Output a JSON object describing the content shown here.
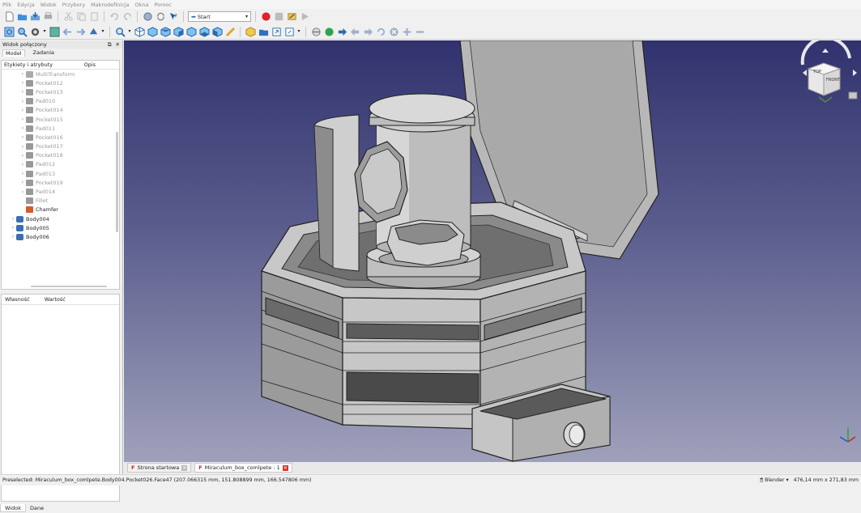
{
  "menu": [
    "Plik",
    "Edycja",
    "Widok",
    "Przybory",
    "Makrodefinicja",
    "Okna",
    "Pomoc"
  ],
  "toolbar": {
    "workbench": "Start"
  },
  "panel": {
    "title": "Widok połączony",
    "tabs": [
      "Model",
      "Zadania"
    ],
    "tree_header": {
      "col1": "Etykiety i atrybuty",
      "col2": "Opis"
    },
    "tree_items": [
      {
        "label": "MultiTransform",
        "icon": "multitransform-icon",
        "greyed": true,
        "child": true
      },
      {
        "label": "Pocket012",
        "icon": "pocket-icon",
        "greyed": true,
        "child": true
      },
      {
        "label": "Pocket013",
        "icon": "pocket-icon",
        "greyed": true,
        "child": true
      },
      {
        "label": "Pad010",
        "icon": "pad-icon",
        "greyed": true,
        "child": true
      },
      {
        "label": "Pocket014",
        "icon": "pocket-icon",
        "greyed": true,
        "child": true
      },
      {
        "label": "Pocket015",
        "icon": "pocket-icon",
        "greyed": true,
        "child": true
      },
      {
        "label": "Pad011",
        "icon": "pad-icon",
        "greyed": true,
        "child": true
      },
      {
        "label": "Pocket016",
        "icon": "pocket-icon",
        "greyed": true,
        "child": true
      },
      {
        "label": "Pocket017",
        "icon": "pocket-icon",
        "greyed": true,
        "child": true
      },
      {
        "label": "Pocket018",
        "icon": "pocket-icon",
        "greyed": true,
        "child": true
      },
      {
        "label": "Pad012",
        "icon": "pad-icon",
        "greyed": true,
        "child": true
      },
      {
        "label": "Pad013",
        "icon": "pad-icon",
        "greyed": true,
        "child": true
      },
      {
        "label": "Pocket019",
        "icon": "pocket-icon",
        "greyed": true,
        "child": true
      },
      {
        "label": "Pad014",
        "icon": "pad-icon",
        "greyed": true,
        "child": true
      },
      {
        "label": "Fillet",
        "icon": "fillet-icon",
        "greyed": true,
        "child": true
      },
      {
        "label": "Chamfer",
        "icon": "chamfer-icon",
        "greyed": false,
        "child": true
      },
      {
        "label": "Body004",
        "icon": "body-icon",
        "greyed": false,
        "child": false
      },
      {
        "label": "Body005",
        "icon": "body-icon",
        "greyed": false,
        "child": false
      },
      {
        "label": "Body006",
        "icon": "body-icon",
        "greyed": false,
        "child": false
      }
    ],
    "props_header": {
      "col1": "Własność",
      "col2": "Wartość"
    },
    "bottom_tabs": [
      "Widok",
      "Dane"
    ]
  },
  "doc_tabs": [
    {
      "label": "Strona startowa",
      "active": false
    },
    {
      "label": "Miraculum_box_comlpete : 1",
      "active": true
    }
  ],
  "navcube": {
    "top": "TOP",
    "front": "FRONT"
  },
  "status": {
    "preselected": "Preselected: Miraculum_box_comlpete.Body004.Pocket026.Face47 (207.066315 mm, 151.808899 mm, 166.547806 mm)",
    "nav_style": "Blender",
    "dimensions": "476,14 mm x 271,83 mm"
  },
  "colors": {
    "view_top": "#31326e",
    "view_bottom": "#9fa1bb",
    "record": "#e0202a",
    "model_grey": "#c8c8c8"
  }
}
